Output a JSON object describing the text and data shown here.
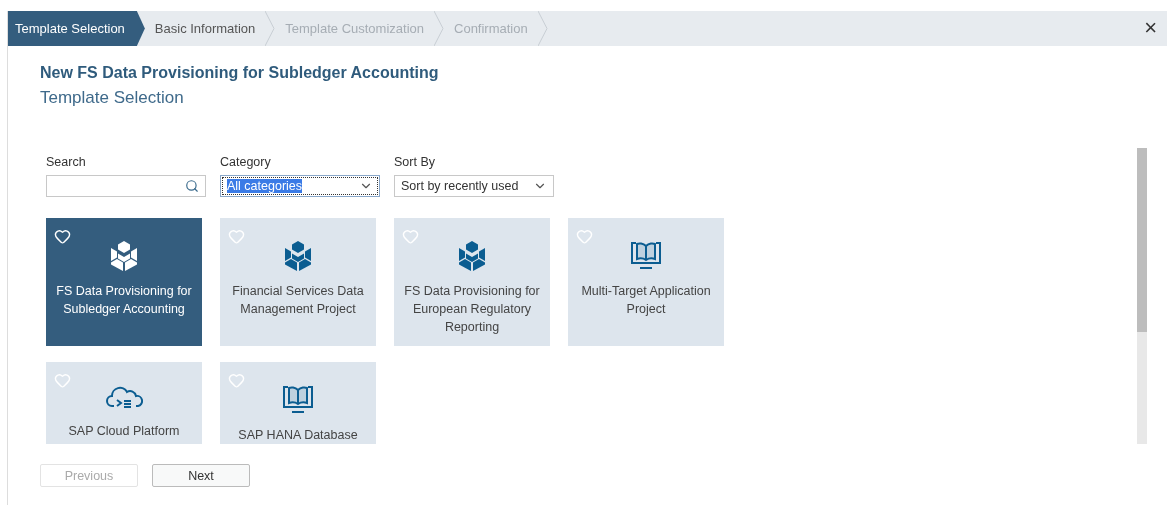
{
  "steps": [
    {
      "label": "Template Selection",
      "selected": true,
      "disabled": false
    },
    {
      "label": "Basic Information",
      "selected": false,
      "disabled": false
    },
    {
      "label": "Template Customization",
      "selected": false,
      "disabled": true
    },
    {
      "label": "Confirmation",
      "selected": false,
      "disabled": true
    }
  ],
  "close": "×",
  "title": "New FS Data Provisioning for Subledger Accounting",
  "subtitle": "Template Selection",
  "filters": [
    {
      "kind": "search",
      "label": "Search"
    },
    {
      "kind": "select",
      "label": "Category",
      "value": "All categories",
      "focused": true
    },
    {
      "kind": "select",
      "label": "Sort By",
      "value": "Sort by recently used",
      "focused": false
    }
  ],
  "templates": [
    {
      "name": "FS Data Provisioning for Subledger Accounting",
      "kind": "cubes",
      "selected": true,
      "favorite": false
    },
    {
      "name": "Financial Services Data Management Project",
      "kind": "cubes",
      "selected": false,
      "favorite": false
    },
    {
      "name": "FS Data Provisioning for European Regulatory Reporting",
      "kind": "cubes",
      "selected": false,
      "favorite": false
    },
    {
      "name": "Multi-Target Application Project",
      "kind": "monitor-book",
      "selected": false,
      "favorite": false
    },
    {
      "name": "SAP Cloud Platform",
      "kind": "cloud-code",
      "selected": false,
      "favorite": false
    },
    {
      "name": "SAP HANA Database",
      "kind": "monitor-book",
      "selected": false,
      "favorite": false
    }
  ],
  "buttons": [
    {
      "label": "Previous",
      "disabled": true
    },
    {
      "label": "Next",
      "disabled": false
    }
  ]
}
